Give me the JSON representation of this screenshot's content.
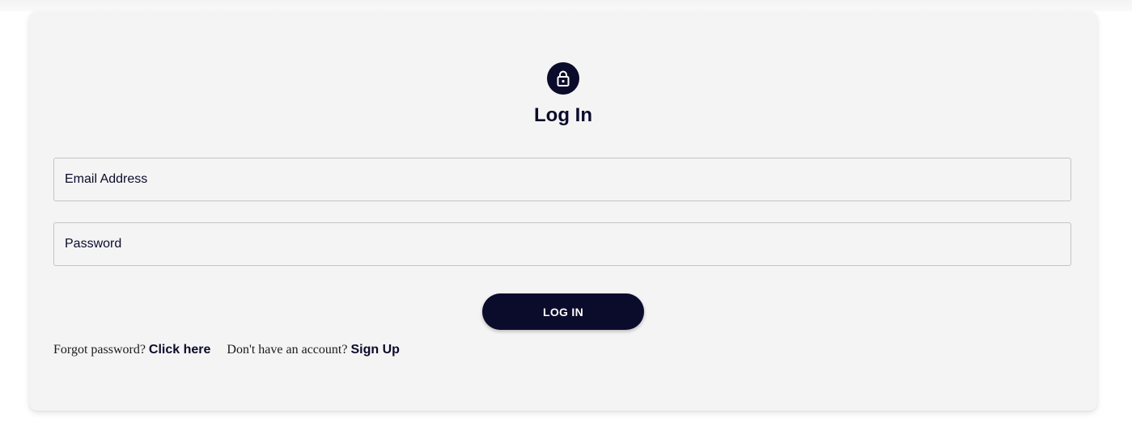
{
  "form": {
    "title": "Log In",
    "icon": "lock-icon",
    "email_placeholder": "Email Address",
    "password_placeholder": "Password",
    "submit_label": "LOG IN"
  },
  "links": {
    "forgot_text": "Forgot password?",
    "forgot_link": "Click here",
    "signup_text": "Don't have an account?",
    "signup_link": "Sign Up"
  },
  "colors": {
    "primary": "#0b0b2b",
    "card_background": "#f4f4f4",
    "field_border": "#c4c4c4"
  }
}
